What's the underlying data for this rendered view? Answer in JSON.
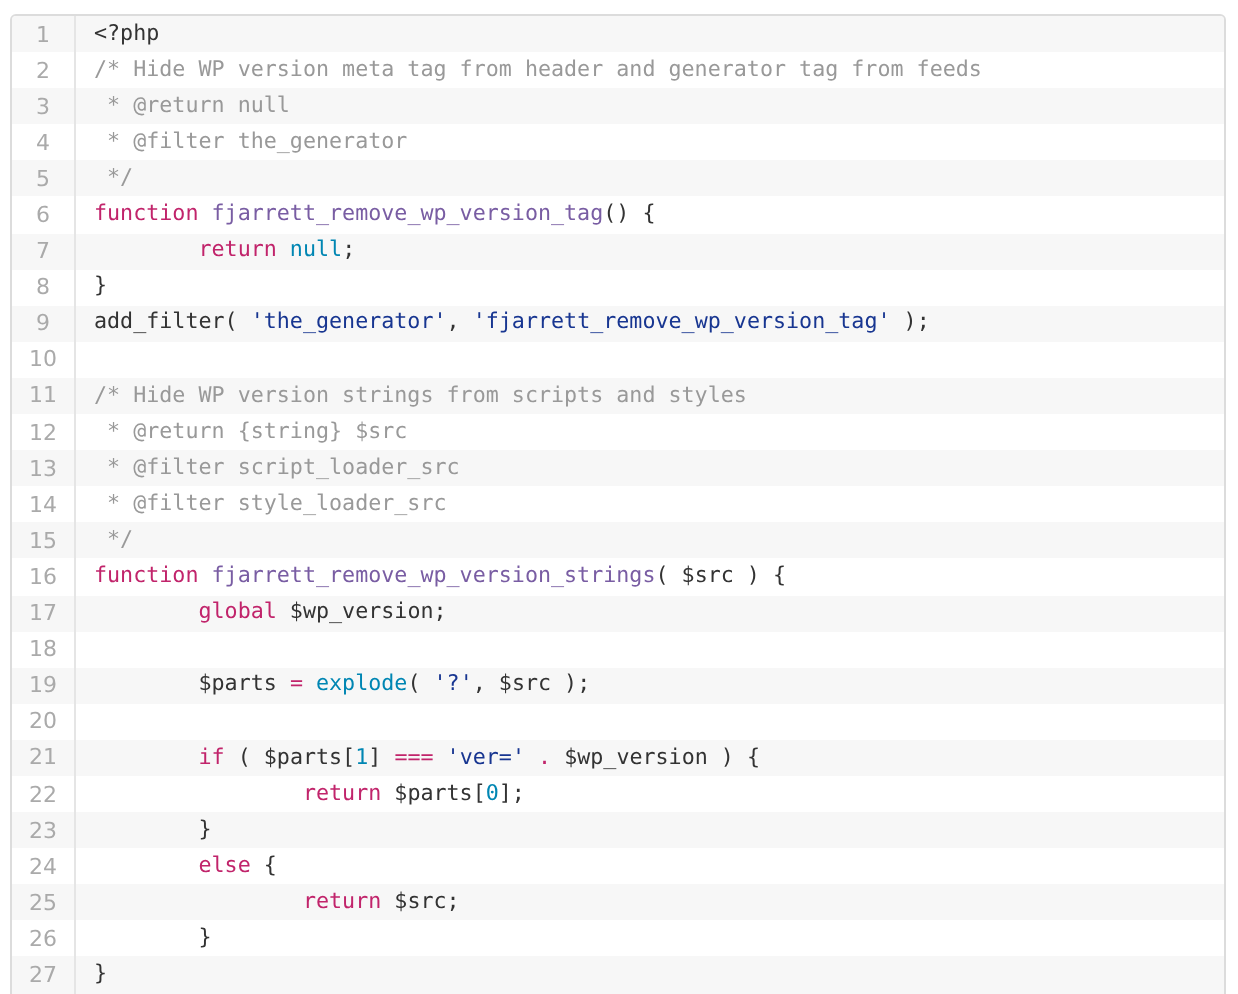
{
  "code_view": {
    "lines": [
      {
        "number": "1",
        "tokens": [
          {
            "kind": "plain",
            "text": "<?php"
          }
        ]
      },
      {
        "number": "2",
        "tokens": [
          {
            "kind": "comment",
            "text": "/* Hide WP version meta tag from header and generator tag from feeds"
          }
        ]
      },
      {
        "number": "3",
        "tokens": [
          {
            "kind": "comment",
            "text": " * @return null"
          }
        ]
      },
      {
        "number": "4",
        "tokens": [
          {
            "kind": "comment",
            "text": " * @filter the_generator"
          }
        ]
      },
      {
        "number": "5",
        "tokens": [
          {
            "kind": "comment",
            "text": " */"
          }
        ]
      },
      {
        "number": "6",
        "tokens": [
          {
            "kind": "keyword",
            "text": "function"
          },
          {
            "kind": "function_name",
            "text": " fjarrett_remove_wp_version_tag"
          },
          {
            "kind": "plain",
            "text": "() {"
          }
        ]
      },
      {
        "number": "7",
        "tokens": [
          {
            "kind": "keyword",
            "text": "\treturn"
          },
          {
            "kind": "builtin",
            "text": " null"
          },
          {
            "kind": "plain",
            "text": ";"
          }
        ]
      },
      {
        "number": "8",
        "tokens": [
          {
            "kind": "plain",
            "text": "}"
          }
        ]
      },
      {
        "number": "9",
        "tokens": [
          {
            "kind": "plain",
            "text": "add_filter( "
          },
          {
            "kind": "string",
            "text": "'the_generator'"
          },
          {
            "kind": "plain",
            "text": ", "
          },
          {
            "kind": "string",
            "text": "'fjarrett_remove_wp_version_tag'"
          },
          {
            "kind": "plain",
            "text": " );"
          }
        ]
      },
      {
        "number": "10"
      },
      {
        "number": "11",
        "tokens": [
          {
            "kind": "comment",
            "text": "/* Hide WP version strings from scripts and styles"
          }
        ]
      },
      {
        "number": "12",
        "tokens": [
          {
            "kind": "comment",
            "text": " * @return {string} $src"
          }
        ]
      },
      {
        "number": "13",
        "tokens": [
          {
            "kind": "comment",
            "text": " * @filter script_loader_src"
          }
        ]
      },
      {
        "number": "14",
        "tokens": [
          {
            "kind": "comment",
            "text": " * @filter style_loader_src"
          }
        ]
      },
      {
        "number": "15",
        "tokens": [
          {
            "kind": "comment",
            "text": " */"
          }
        ]
      },
      {
        "number": "16",
        "tokens": [
          {
            "kind": "keyword",
            "text": "function"
          },
          {
            "kind": "function_name",
            "text": " fjarrett_remove_wp_version_strings"
          },
          {
            "kind": "plain",
            "text": "( $src ) {"
          }
        ]
      },
      {
        "number": "17",
        "tokens": [
          {
            "kind": "keyword",
            "text": "\tglobal"
          },
          {
            "kind": "plain",
            "text": " $wp_version;"
          }
        ]
      },
      {
        "number": "18"
      },
      {
        "number": "19",
        "tokens": [
          {
            "kind": "plain",
            "text": "\t$parts "
          },
          {
            "kind": "operator",
            "text": "="
          },
          {
            "kind": "builtin",
            "text": " explode"
          },
          {
            "kind": "plain",
            "text": "( "
          },
          {
            "kind": "string",
            "text": "'?'"
          },
          {
            "kind": "plain",
            "text": ", $src );"
          }
        ]
      },
      {
        "number": "20"
      },
      {
        "number": "21",
        "tokens": [
          {
            "kind": "keyword",
            "text": "\tif"
          },
          {
            "kind": "plain",
            "text": " ( $parts["
          },
          {
            "kind": "builtin",
            "text": "1"
          },
          {
            "kind": "plain",
            "text": "] "
          },
          {
            "kind": "operator",
            "text": "==="
          },
          {
            "kind": "string",
            "text": " 'ver='"
          },
          {
            "kind": "operator",
            "text": " ."
          },
          {
            "kind": "plain",
            "text": " $wp_version ) {"
          }
        ]
      },
      {
        "number": "22",
        "tokens": [
          {
            "kind": "keyword",
            "text": "\t\treturn"
          },
          {
            "kind": "plain",
            "text": " $parts["
          },
          {
            "kind": "builtin",
            "text": "0"
          },
          {
            "kind": "plain",
            "text": "];"
          }
        ]
      },
      {
        "number": "23",
        "tokens": [
          {
            "kind": "plain",
            "text": "\t}"
          }
        ]
      },
      {
        "number": "24",
        "tokens": [
          {
            "kind": "keyword",
            "text": "\telse"
          },
          {
            "kind": "plain",
            "text": " {"
          }
        ]
      },
      {
        "number": "25",
        "tokens": [
          {
            "kind": "keyword",
            "text": "\t\treturn"
          },
          {
            "kind": "plain",
            "text": " $src;"
          }
        ]
      },
      {
        "number": "26",
        "tokens": [
          {
            "kind": "plain",
            "text": "\t}"
          }
        ]
      },
      {
        "number": "27",
        "tokens": [
          {
            "kind": "plain",
            "text": "}"
          }
        ]
      }
    ]
  }
}
